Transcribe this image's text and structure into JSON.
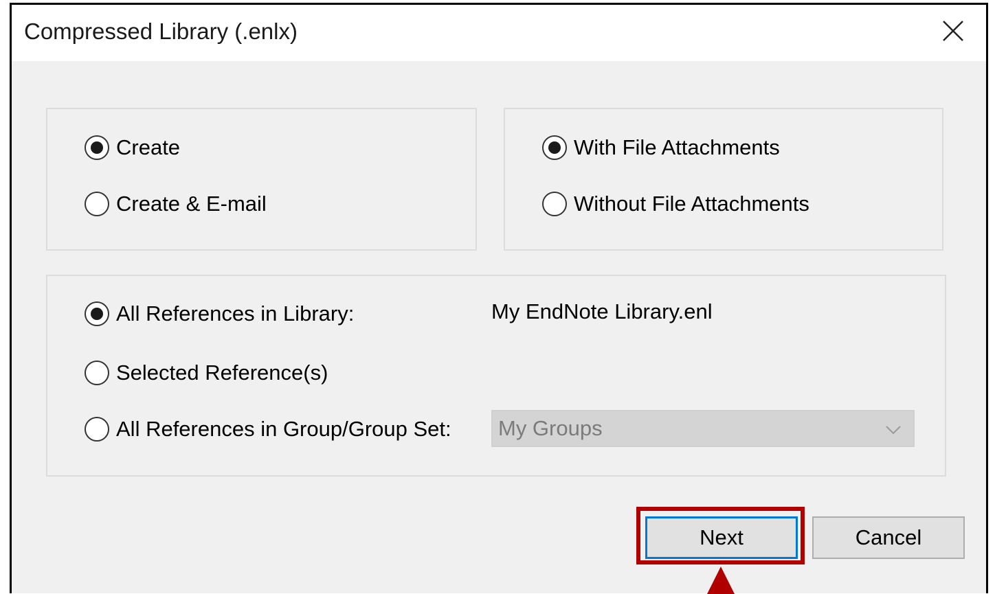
{
  "window": {
    "title": "Compressed Library (.enlx)",
    "close_icon": "close-icon"
  },
  "action_group": {
    "options": [
      {
        "label": "Create",
        "selected": true
      },
      {
        "label": "Create & E-mail",
        "selected": false
      }
    ]
  },
  "attachments_group": {
    "options": [
      {
        "label": "With File Attachments",
        "selected": true
      },
      {
        "label": "Without File Attachments",
        "selected": false
      }
    ]
  },
  "references_group": {
    "options": [
      {
        "label": "All References in Library:",
        "selected": true
      },
      {
        "label": "Selected Reference(s)",
        "selected": false
      },
      {
        "label": "All References in Group/Group Set:",
        "selected": false
      }
    ],
    "library_name": "My EndNote Library.enl",
    "group_dropdown": {
      "value": "My Groups",
      "disabled": true
    }
  },
  "buttons": {
    "next": "Next",
    "cancel": "Cancel"
  },
  "colors": {
    "highlight": "#b00000",
    "focus_border": "#0078d7"
  }
}
